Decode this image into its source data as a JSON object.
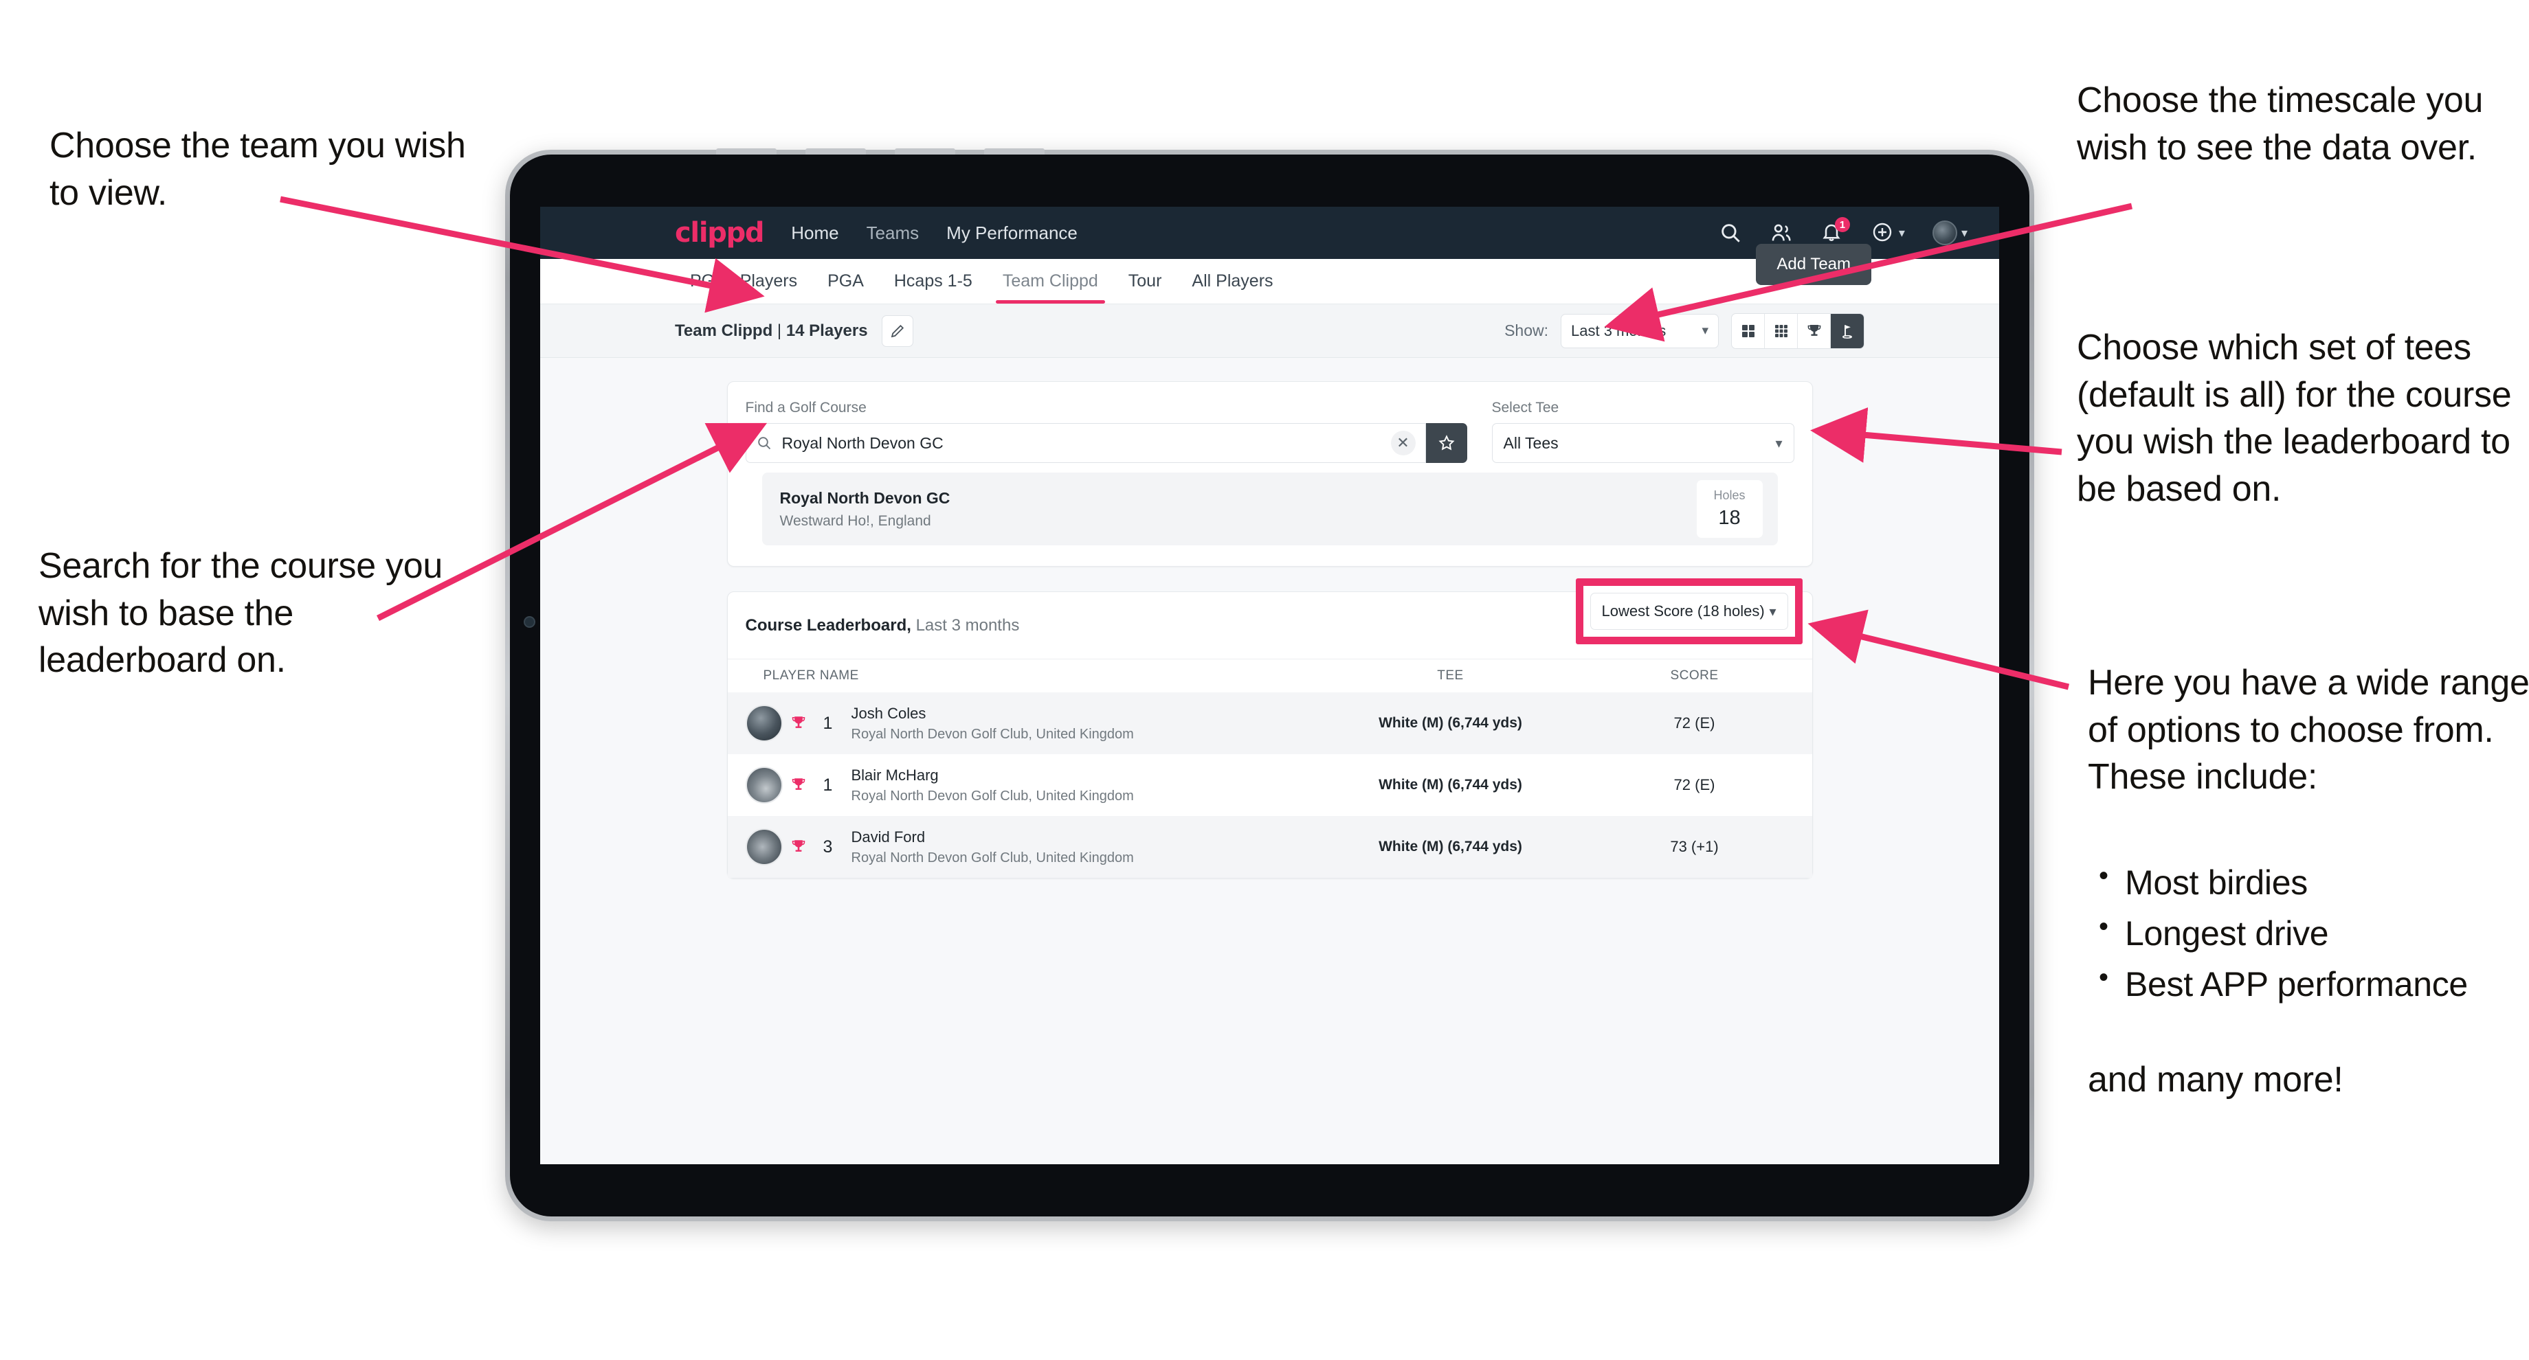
{
  "annotations": {
    "team": "Choose the team you wish to view.",
    "search": "Search for the course you wish to base the leaderboard on.",
    "timescale": "Choose the timescale you wish to see the data over.",
    "tees": "Choose which set of tees (default is all) for the course you wish the leaderboard to be based on.",
    "options_intro": "Here you have a wide range of options to choose from. These include:",
    "options_list": [
      "Most birdies",
      "Longest drive",
      "Best APP performance"
    ],
    "options_more": "and many more!"
  },
  "app": {
    "navbar": {
      "logo": "clippd",
      "links": [
        "Home",
        "Teams",
        "My Performance"
      ],
      "icons": [
        "search-icon",
        "people-icon",
        "bell-icon",
        "plus-circle-icon",
        "avatar-icon"
      ],
      "notification_count": "1"
    },
    "team_tabs": {
      "items": [
        "PGAT Players",
        "PGA",
        "Hcaps 1-5",
        "Team Clippd",
        "Tour",
        "All Players"
      ],
      "active": "Team Clippd",
      "add_team_label": "Add Team"
    },
    "toolbar": {
      "team_name": "Team Clippd",
      "team_separator": " | ",
      "player_count": "14 Players",
      "edit_icon": "pencil-icon",
      "show_label": "Show:",
      "show_value": "Last 3 months",
      "view_toggles": [
        "grid-2x2-icon",
        "grid-3x3-icon",
        "trophy-icon",
        "golf-flag-icon"
      ],
      "active_view": "golf-flag-icon"
    },
    "search_card": {
      "course_label": "Find a Golf Course",
      "course_value": "Royal North Devon GC",
      "course_placeholder": "Find a Golf Course",
      "clear_label": "✕",
      "star_icon": "star-icon",
      "tee_label": "Select Tee",
      "tee_value": "All Tees"
    },
    "course_result": {
      "name": "Royal North Devon GC",
      "location": "Westward Ho!, England",
      "holes_label": "Holes",
      "holes_value": "18"
    },
    "leaderboard": {
      "title": "Course Leaderboard,",
      "subtitle": " Last 3 months",
      "metric_value": "Lowest Score (18 holes)",
      "columns": [
        "PLAYER NAME",
        "TEE",
        "SCORE"
      ],
      "rows": [
        {
          "rank": "1",
          "name": "Josh Coles",
          "club": "Royal North Devon Golf Club, United Kingdom",
          "tee": "White (M) (6,744 yds)",
          "score": "72 (E)"
        },
        {
          "rank": "1",
          "name": "Blair McHarg",
          "club": "Royal North Devon Golf Club, United Kingdom",
          "tee": "White (M) (6,744 yds)",
          "score": "72 (E)"
        },
        {
          "rank": "3",
          "name": "David Ford",
          "club": "Royal North Devon Golf Club, United Kingdom",
          "tee": "White (M) (6,744 yds)",
          "score": "73 (+1)"
        }
      ]
    }
  },
  "colors": {
    "accent_pink": "#ec2d68",
    "navbar_dark": "#1b2834",
    "button_dark": "#3d464e",
    "page_bg": "#f7f8fa"
  }
}
